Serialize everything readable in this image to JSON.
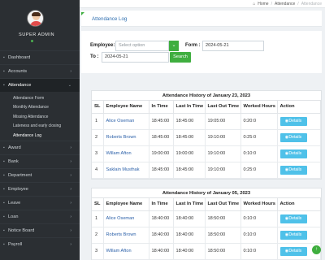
{
  "sidebar": {
    "admin_name": "SUPER ADMIN",
    "items": [
      {
        "label": "Dashboard",
        "icon": "dashboard-icon"
      },
      {
        "label": "Accounts",
        "icon": "accounts-icon"
      },
      {
        "label": "Attendance",
        "icon": "attendance-icon"
      },
      {
        "label": "Award",
        "icon": "award-icon"
      },
      {
        "label": "Bank",
        "icon": "bank-icon"
      },
      {
        "label": "Department",
        "icon": "department-icon"
      },
      {
        "label": "Employee",
        "icon": "employee-icon"
      },
      {
        "label": "Leave",
        "icon": "leave-icon"
      },
      {
        "label": "Loan",
        "icon": "loan-icon"
      },
      {
        "label": "Notice Board",
        "icon": "notice-icon"
      },
      {
        "label": "Payroll",
        "icon": "payroll-icon"
      }
    ],
    "attendance_sub": [
      "Attendance Form",
      "Monthly Attendance",
      "Missing Attendance",
      "Lateness and early closing",
      "Attendance Log"
    ]
  },
  "breadcrumb": {
    "home": "Home",
    "section": "Attendance",
    "current": "Attendance"
  },
  "page": {
    "title": "Attendance Log"
  },
  "filters": {
    "employee_label": "Employee:",
    "employee_placeholder": "Select option",
    "form_label": "Form :",
    "form_value": "2024-05-21",
    "to_label": "To :",
    "to_value": "2024-05-21",
    "search_label": "Search"
  },
  "columns": [
    "SL",
    "Employee Name",
    "In Time",
    "Last In Time",
    "Last Out Time",
    "Worked Hours",
    "Action"
  ],
  "details_label": "Details",
  "tables": [
    {
      "title": "Attendance History of January 23, 2023",
      "rows": [
        [
          "1",
          "Alice Oseman",
          "18:45:00",
          "18:45:00",
          "19:05:00",
          "0:20:0"
        ],
        [
          "2",
          "Roberts Brown",
          "18:45:00",
          "18:45:00",
          "19:10:00",
          "0:25:0"
        ],
        [
          "3",
          "Willam Afton",
          "19:00:00",
          "19:00:00",
          "19:10:00",
          "0:10:0"
        ],
        [
          "4",
          "Saklain Musthak",
          "18:45:00",
          "18:45:00",
          "19:10:00",
          "0:25:0"
        ]
      ]
    },
    {
      "title": "Attendance History of January 05, 2023",
      "rows": [
        [
          "1",
          "Alice Oseman",
          "18:40:00",
          "18:40:00",
          "18:50:00",
          "0:10:0"
        ],
        [
          "2",
          "Roberts Brown",
          "18:40:00",
          "18:40:00",
          "18:50:00",
          "0:10:0"
        ],
        [
          "3",
          "Willam Afton",
          "18:40:00",
          "18:40:00",
          "18:50:00",
          "0:10:0"
        ]
      ]
    }
  ]
}
